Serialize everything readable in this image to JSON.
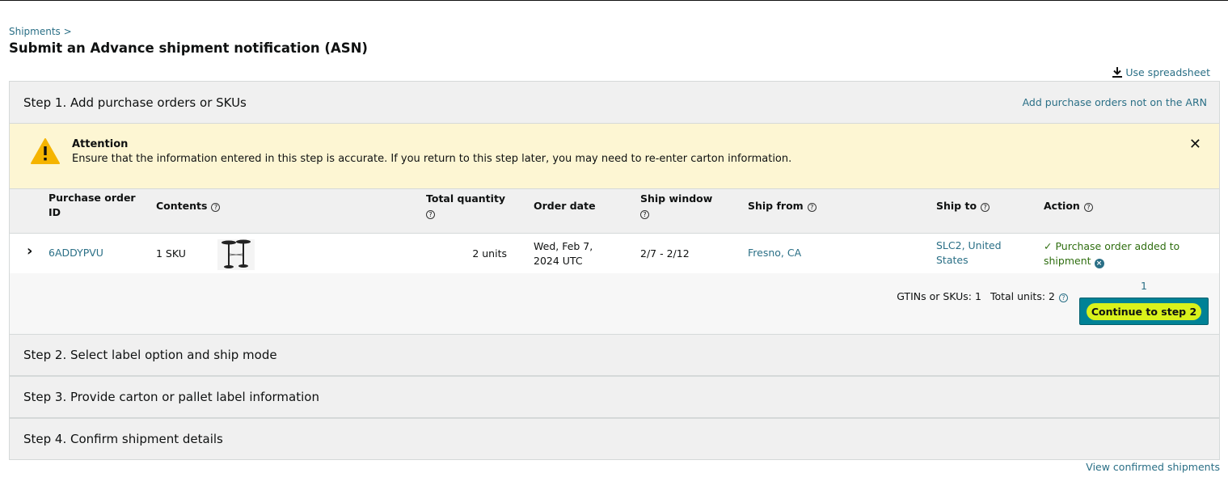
{
  "breadcrumb": {
    "shipments": "Shipments",
    "sep": ">"
  },
  "page": {
    "title": "Submit an Advance shipment notification (ASN)"
  },
  "spreadsheet": {
    "label": "Use spreadsheet",
    "icon": "download-icon"
  },
  "step1": {
    "title": "Step 1. Add purchase orders or SKUs",
    "right_link": "Add purchase orders not on the ARN"
  },
  "alert": {
    "title": "Attention",
    "message": "Ensure that the information entered in this step is accurate. If you return to this step later, you may need to re-enter carton information.",
    "close": "✕"
  },
  "table": {
    "headers": {
      "po_line1": "Purchase order",
      "po_line2": "ID",
      "contents": "Contents",
      "total_qty": "Total quantity",
      "order_date": "Order date",
      "ship_window": "Ship window",
      "ship_from": "Ship from",
      "ship_to": "Ship to",
      "action": "Action"
    },
    "help_glyph": "?",
    "rows": [
      {
        "expand": "›",
        "po_id": "6ADDYPVU",
        "contents": "1 SKU",
        "quantity": "2 units",
        "order_date_line1": "Wed, Feb 7,",
        "order_date_line2": "2024 UTC",
        "ship_window": "2/7 - 2/12",
        "ship_from": "Fresno, CA",
        "ship_to_line1": "SLC2, United",
        "ship_to_line2": "States",
        "action_check": "✓",
        "action_line1": "Purchase order added to",
        "action_line2": "shipment",
        "action_remove": "×"
      }
    ]
  },
  "summary": {
    "page_number": "1",
    "gtins": "GTINs or SKUs: 1",
    "total_units": "Total units: 2",
    "continue": "Continue to step 2"
  },
  "steps": [
    {
      "title": "Step 2. Select label option and ship mode"
    },
    {
      "title": "Step 3. Provide carton or pallet label information"
    },
    {
      "title": "Step 4. Confirm shipment details"
    }
  ],
  "footer": {
    "view_confirmed": "View confirmed shipments"
  },
  "colors": {
    "link": "#2a6f86",
    "button": "#008296",
    "highlight": "#d9f21b",
    "alert_bg": "#fdf6d3",
    "success": "#2f6e10"
  }
}
